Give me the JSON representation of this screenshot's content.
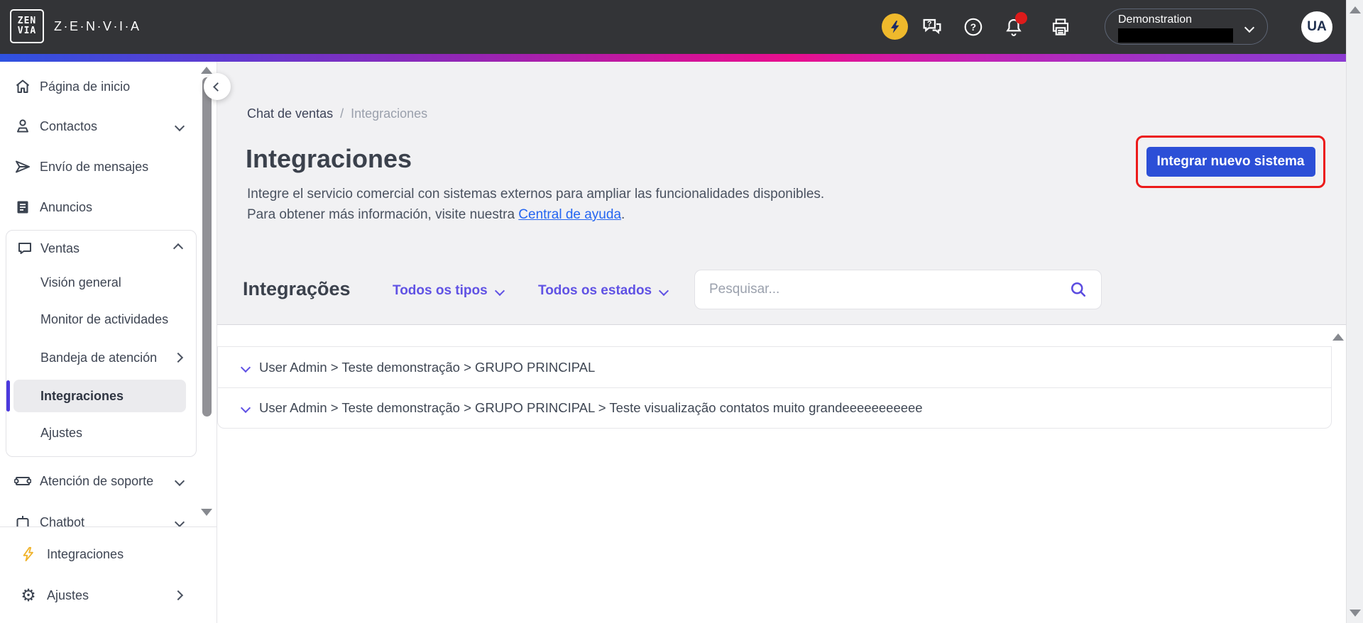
{
  "topbar": {
    "logo_top": "ZEN",
    "logo_bottom": "VIA",
    "brand": "Z·E·N·V·I·A",
    "org_name": "Demonstration",
    "avatar_initials": "UA"
  },
  "icons": {
    "question_glyph": "?",
    "gear_glyph": "⚙"
  },
  "sidebar": {
    "items": [
      {
        "label": "Página de inicio"
      },
      {
        "label": "Contactos"
      },
      {
        "label": "Envío de mensajes"
      },
      {
        "label": "Anuncios"
      }
    ],
    "ventas": {
      "label": "Ventas",
      "children": [
        "Visión general",
        "Monitor de actividades",
        "Bandeja de atención",
        "Integraciones",
        "Ajustes"
      ],
      "selected": "Integraciones"
    },
    "below": [
      {
        "label": "Atención de soporte"
      },
      {
        "label": "Chatbot"
      }
    ],
    "pinned": [
      {
        "label": "Integraciones"
      },
      {
        "label": "Ajustes"
      }
    ]
  },
  "breadcrumb": {
    "parent": "Chat de ventas",
    "separator": "/",
    "current": "Integraciones"
  },
  "page": {
    "title": "Integraciones",
    "description_before_link": "Integre el servicio comercial con sistemas externos para ampliar las funcionalidades disponibles. Para obtener más información, visite nuestra ",
    "link_text": "Central de ayuda",
    "description_after_link": ".",
    "cta_label": "Integrar nuevo sistema"
  },
  "filters": {
    "section_title": "Integrações",
    "type_filter": "Todos os tipos",
    "status_filter": "Todos os estados",
    "search_placeholder": "Pesquisar..."
  },
  "rows": [
    {
      "label": "User Admin > Teste demonstração > GRUPO PRINCIPAL"
    },
    {
      "label": "User Admin > Teste demonstração > GRUPO PRINCIPAL > Teste visualização contatos muito grandeeeeeeeeeee"
    }
  ],
  "colors": {
    "topbar_bg": "#333437",
    "accent_purple": "#6052e4",
    "selected_bar": "#4b39dd",
    "cta_blue": "#2c4fd7",
    "annotation_red": "#ec1a1a",
    "notification_red": "#dd1b1b",
    "bolt_yellow": "#efb92c",
    "link_blue": "#2465f1",
    "gradient": [
      "#2e52e0",
      "#e80f8e",
      "#8a3bd2"
    ]
  }
}
